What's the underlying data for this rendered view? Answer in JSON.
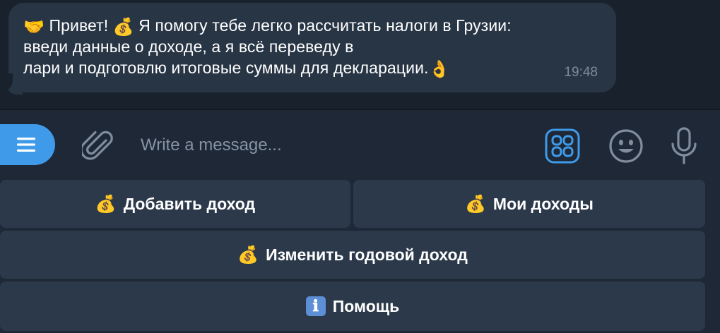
{
  "chat": {
    "message": {
      "line1_emoji": "🤝",
      "line1_text_a": " Привет! ",
      "line1_emoji2": "💰",
      "line1_text_b": " Я помогу тебе легко рассчитать налоги в Грузии:",
      "line2_text": "введи данные о доходе, а я всё переведу в",
      "line3_text": "лари и подготовлю итоговые суммы для декларации.",
      "line3_emoji": "👌",
      "time": "19:48"
    }
  },
  "composer": {
    "placeholder": "Write a message...",
    "menu_icon": "menu-icon",
    "attach_icon": "paperclip-icon",
    "apps_icon": "apps-grid-icon",
    "emoji_icon": "smiley-icon",
    "mic_icon": "microphone-icon"
  },
  "keyboard": {
    "add_income": {
      "emoji": "💰",
      "label": "Добавить доход"
    },
    "my_income": {
      "emoji": "💰",
      "label": "Мои доходы"
    },
    "edit_annual": {
      "emoji": "💰",
      "label": "Изменить годовой доход"
    },
    "help": {
      "icon": "ℹ",
      "label": "Помощь"
    }
  },
  "colors": {
    "background": "#1e2836",
    "chat_background": "#19212c",
    "bubble": "#283545",
    "accent": "#3f9be9",
    "keyboard_button": "#2b394a",
    "muted_text": "#7d8b99"
  }
}
